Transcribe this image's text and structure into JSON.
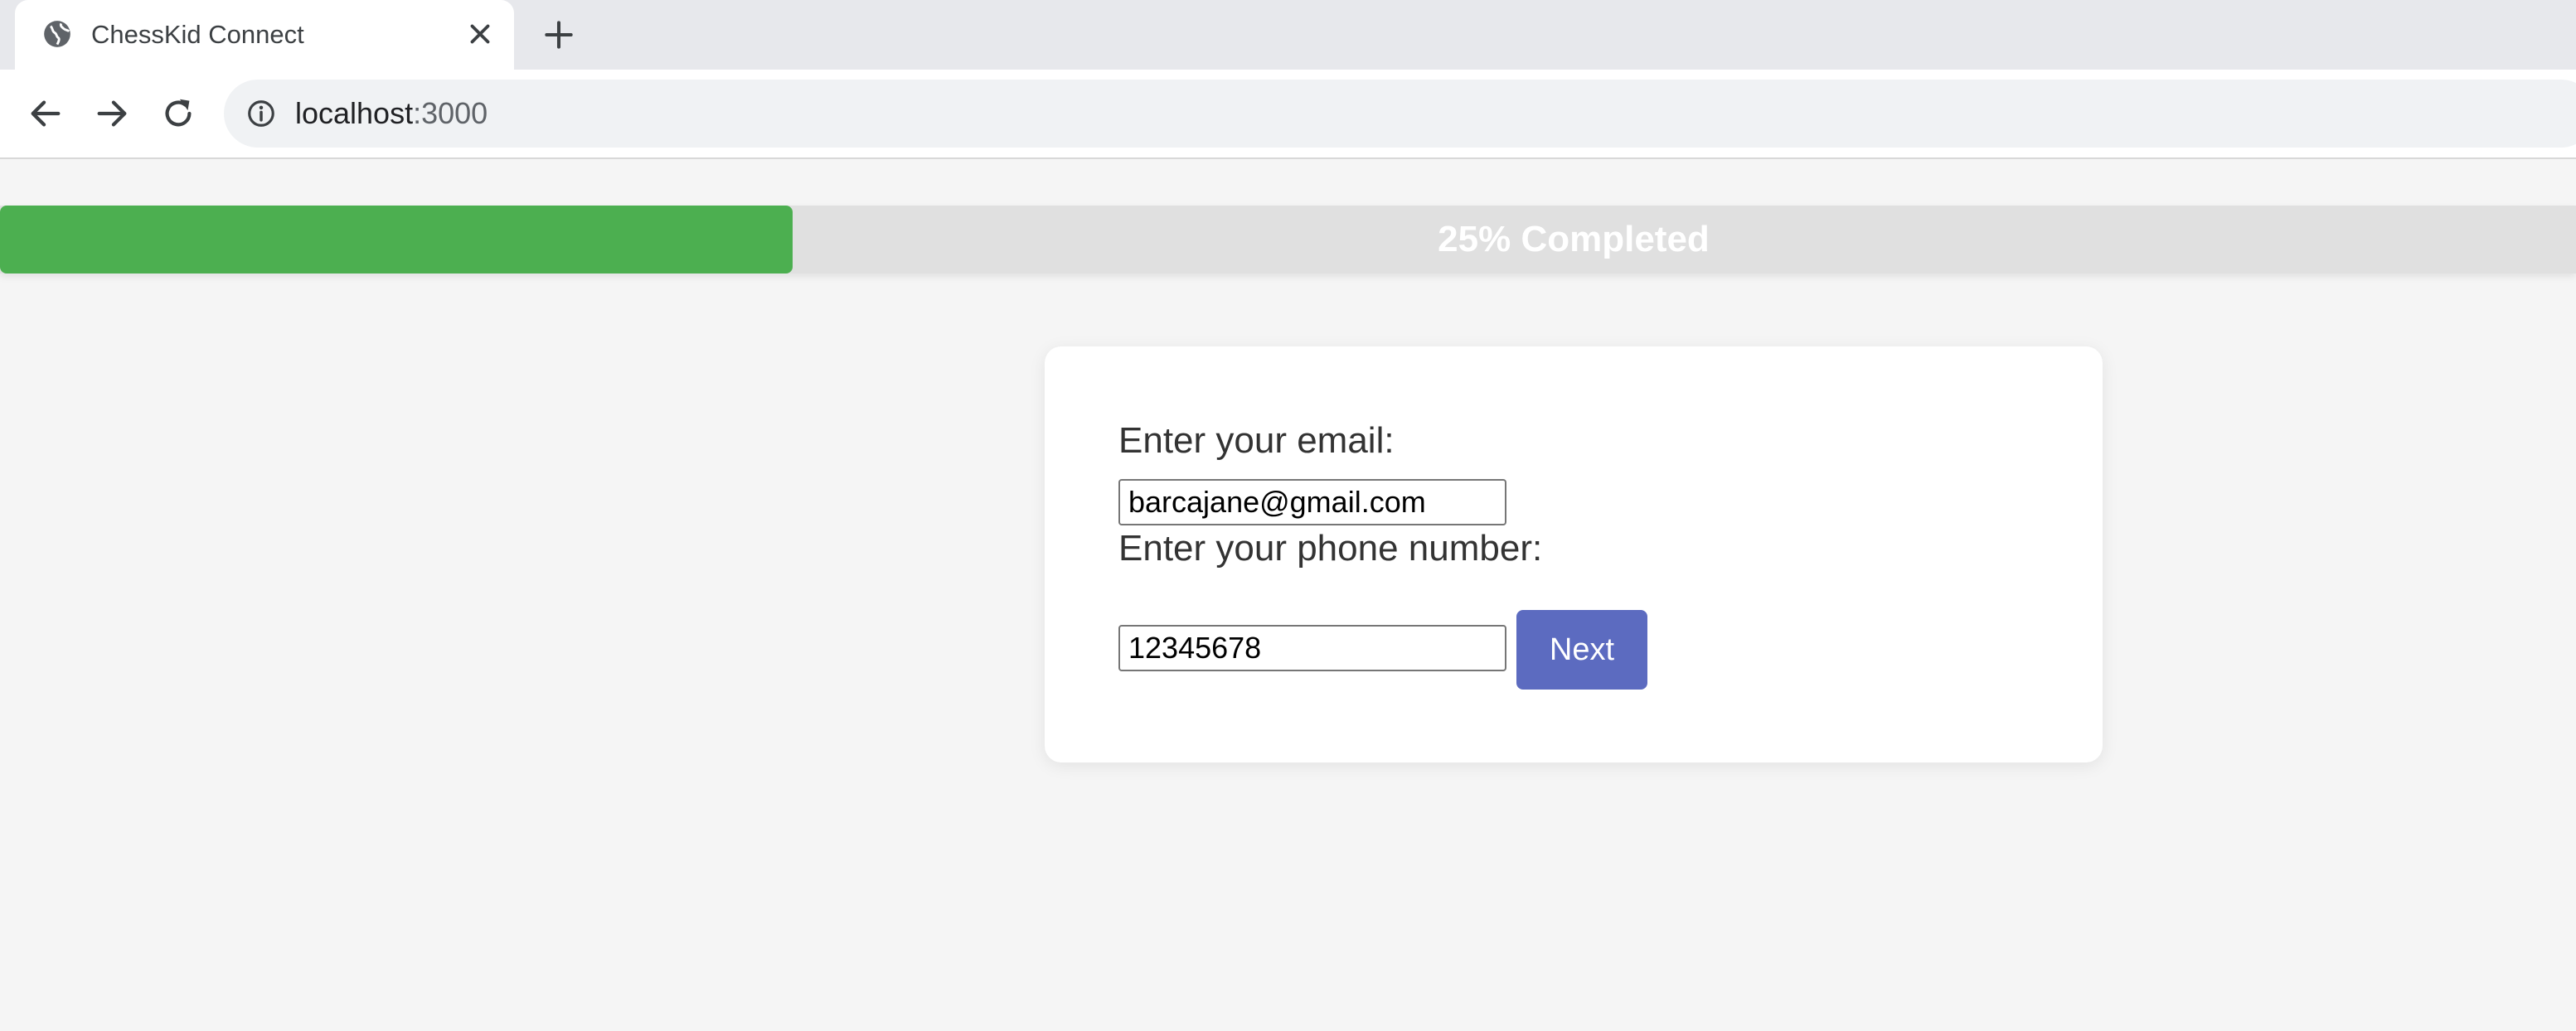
{
  "browser": {
    "tab_title": "ChessKid Connect",
    "url_host": "localhost",
    "url_port": ":3000"
  },
  "icons": {
    "favicon": "globe-icon",
    "close": "close-icon",
    "new_tab": "plus-icon",
    "back": "arrow-left-icon",
    "forward": "arrow-right-icon",
    "reload": "reload-icon",
    "site_info": "info-icon"
  },
  "progress": {
    "percent": 25,
    "label": "25% Completed"
  },
  "form": {
    "email_label": "Enter your email:",
    "email_value": "barcajane@gmail.com",
    "phone_label": "Enter your phone number:",
    "phone_value": "12345678",
    "next_label": "Next"
  },
  "colors": {
    "progress_fill": "#4caf50",
    "progress_track": "#e0e0e0",
    "button": "#5c6bc0",
    "page_background": "#f5f5f5"
  }
}
